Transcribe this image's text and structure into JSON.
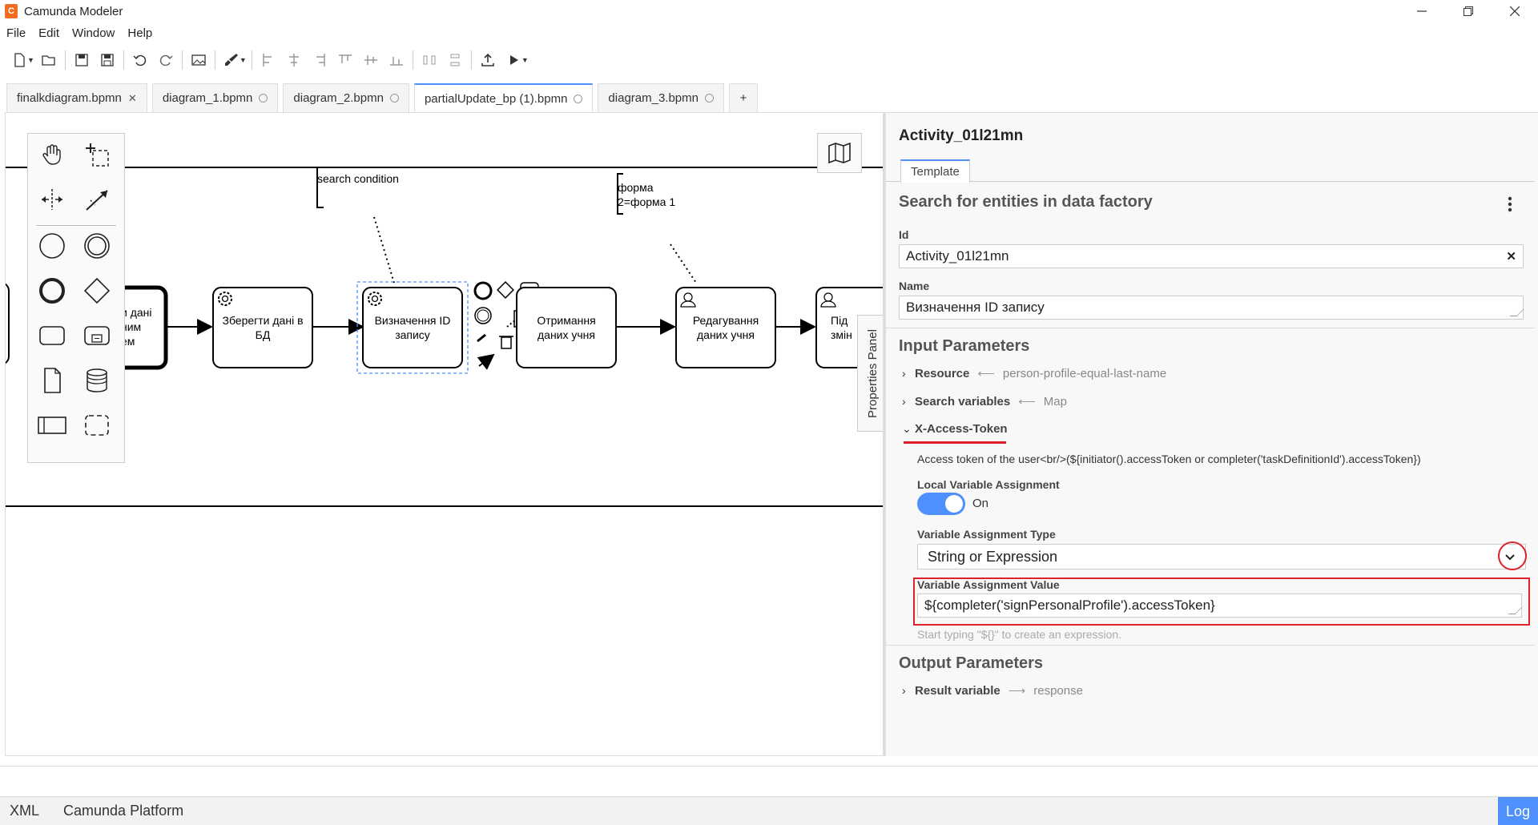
{
  "window": {
    "title": "Camunda Modeler",
    "icon_letter": "C"
  },
  "menu": [
    "File",
    "Edit",
    "Window",
    "Help"
  ],
  "tabs": [
    {
      "label": "finalkdiagram.bpmn",
      "state": "close"
    },
    {
      "label": "diagram_1.bpmn",
      "state": "dot"
    },
    {
      "label": "diagram_2.bpmn",
      "state": "dot"
    },
    {
      "label": "partialUpdate_bp (1).bpmn",
      "state": "dot",
      "active": true
    },
    {
      "label": "diagram_3.bpmn",
      "state": "dot"
    }
  ],
  "tab_add_label": "+",
  "diagram": {
    "annotations": {
      "search_condition": "search condition",
      "form_line1": "форма",
      "form_line2": "2=форма 1"
    },
    "tasks": {
      "partial_left": "и дані\nним\nем",
      "save_data": "Зберегти дані в\nБД",
      "determine_id": "Визначення ID\nзапису",
      "get_student_data": "Отримання\nданих учня",
      "edit_student_data": "Редагування\nданих учня",
      "partial_right": "Під\nзмін"
    }
  },
  "properties_toggle_label": "Properties Panel",
  "properties": {
    "element_id_title": "Activity_01l21mn",
    "tab_label": "Template",
    "template_title": "Search for entities in data factory",
    "id_label": "Id",
    "id_value": "Activity_01l21mn",
    "name_label": "Name",
    "name_value": "Визначення ID запису",
    "input_params_title": "Input Parameters",
    "inputs": [
      {
        "name": "Resource",
        "value": "person-profile-equal-last-name"
      },
      {
        "name": "Search variables",
        "value": "Map"
      },
      {
        "name": "X-Access-Token",
        "value": ""
      }
    ],
    "token_description": "Access token of the user<br/>(${initiator().accessToken or completer('taskDefinitionId').accessToken})",
    "local_var_label": "Local Variable Assignment",
    "local_var_state": "On",
    "var_type_label": "Variable Assignment Type",
    "var_type_value": "String or Expression",
    "var_value_label": "Variable Assignment Value",
    "var_value": "${completer('signPersonalProfile').accessToken}",
    "var_value_hint": "Start typing \"${}\" to create an expression.",
    "output_params_title": "Output Parameters",
    "outputs": [
      {
        "name": "Result variable",
        "value": "response"
      }
    ]
  },
  "statusbar": {
    "xml": "XML",
    "platform": "Camunda Platform",
    "log": "Log"
  }
}
